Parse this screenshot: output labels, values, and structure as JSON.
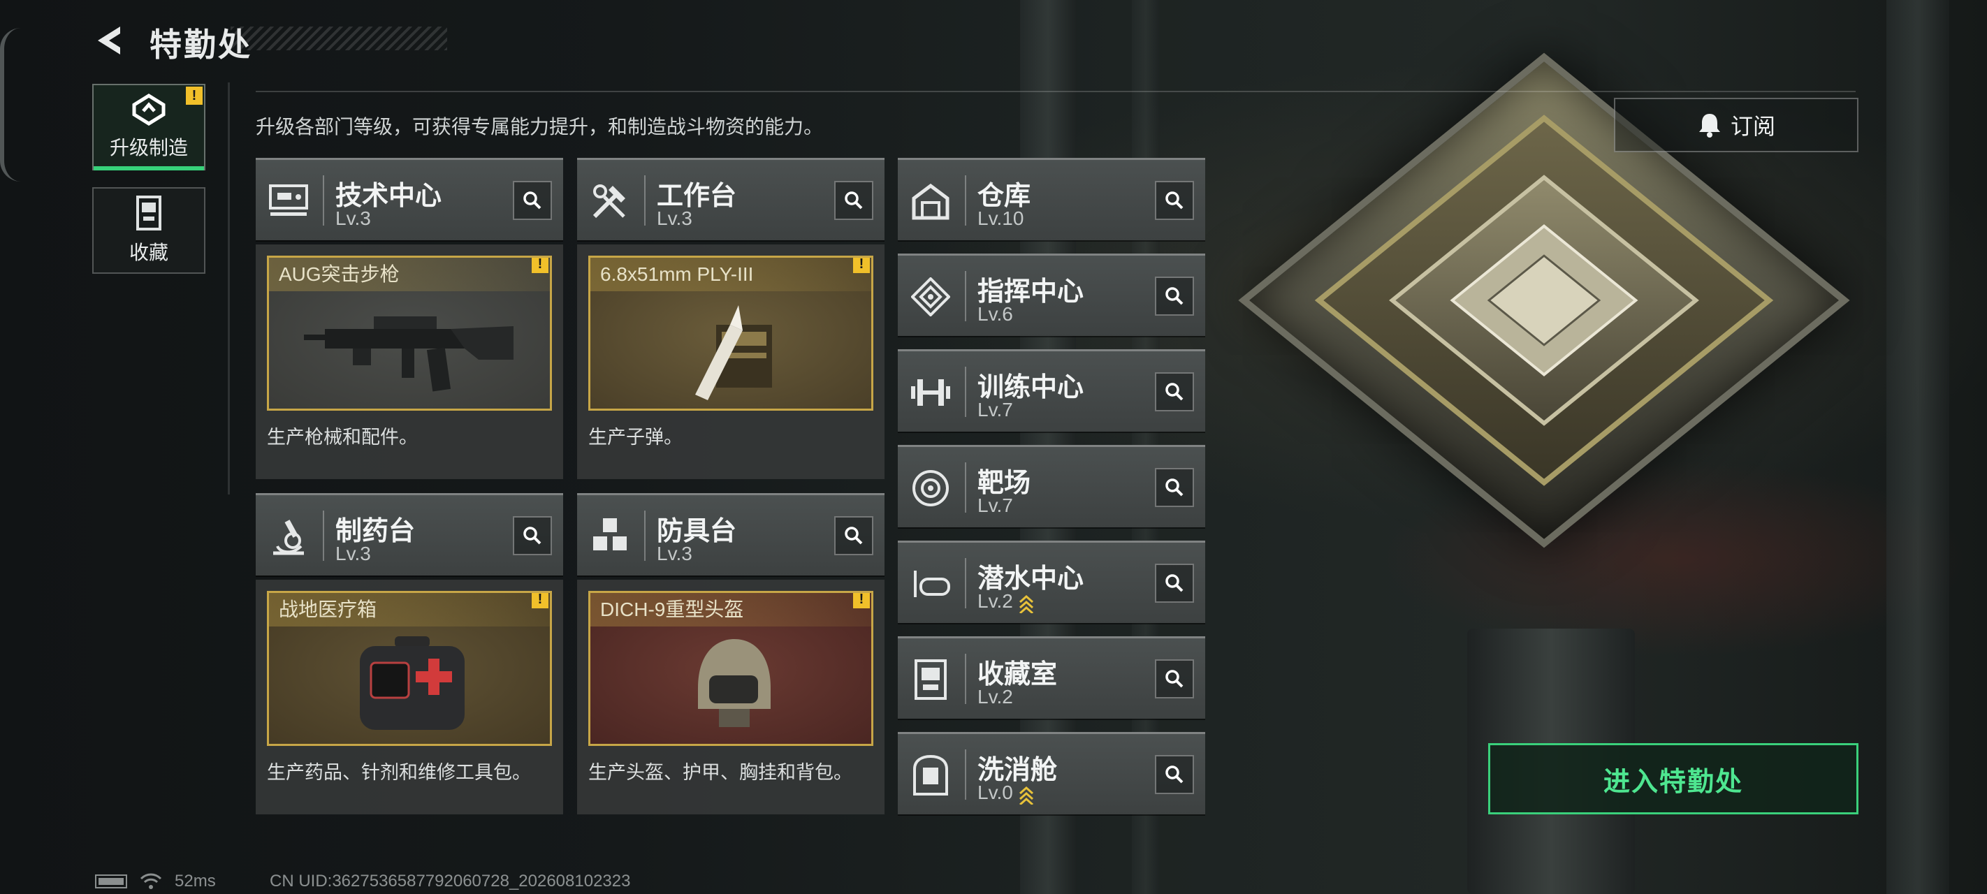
{
  "header": {
    "title": "特勤处"
  },
  "side_nav": [
    {
      "label": "升级制造",
      "icon": "upgrade-icon",
      "active": true,
      "alert": "!"
    },
    {
      "label": "收藏",
      "icon": "collection-icon",
      "active": false
    }
  ],
  "subtitle": "升级各部门等级，可获得专属能力提升，和制造战斗物资的能力。",
  "workshops": [
    {
      "name": "技术中心",
      "level": "Lv.3",
      "icon": "tech-center-icon",
      "product": "AUG突击步枪",
      "product_icon": "rifle-image",
      "desc": "生产枪械和配件。",
      "alert": "!"
    },
    {
      "name": "工作台",
      "level": "Lv.3",
      "icon": "tools-icon",
      "product": "6.8x51mm PLY-III",
      "product_icon": "ammo-image",
      "desc": "生产子弹。",
      "alert": "!"
    },
    {
      "name": "制药台",
      "level": "Lv.3",
      "icon": "microscope-icon",
      "product": "战地医疗箱",
      "product_icon": "medkit-image",
      "desc": "生产药品、针剂和维修工具包。",
      "alert": "!"
    },
    {
      "name": "防具台",
      "level": "Lv.3",
      "icon": "cubes-icon",
      "product": "DICH-9重型头盔",
      "product_icon": "helmet-image",
      "desc": "生产头盔、护甲、胸挂和背包。",
      "alert": "!"
    }
  ],
  "departments": [
    {
      "name": "仓库",
      "level": "Lv.10",
      "icon": "warehouse-icon",
      "upgrade": false
    },
    {
      "name": "指挥中心",
      "level": "Lv.6",
      "icon": "command-icon",
      "upgrade": false
    },
    {
      "name": "训练中心",
      "level": "Lv.7",
      "icon": "dumbbell-icon",
      "upgrade": false
    },
    {
      "name": "靶场",
      "level": "Lv.7",
      "icon": "target-icon",
      "upgrade": false
    },
    {
      "name": "潜水中心",
      "level": "Lv.2",
      "icon": "dive-mask-icon",
      "upgrade": true
    },
    {
      "name": "收藏室",
      "level": "Lv.2",
      "icon": "collection-room-icon",
      "upgrade": false
    },
    {
      "name": "洗消舱",
      "level": "Lv.0",
      "icon": "decon-icon",
      "upgrade": true
    }
  ],
  "subscribe_label": "订阅",
  "enter_label": "进入特勤处",
  "status": {
    "ping": "52ms",
    "uid": "CN UID:3627536587792060728_202608102323"
  },
  "colors": {
    "accent_green": "#3ad07b",
    "warning_yellow": "#f1c02a",
    "product_border": "#c7a647"
  }
}
